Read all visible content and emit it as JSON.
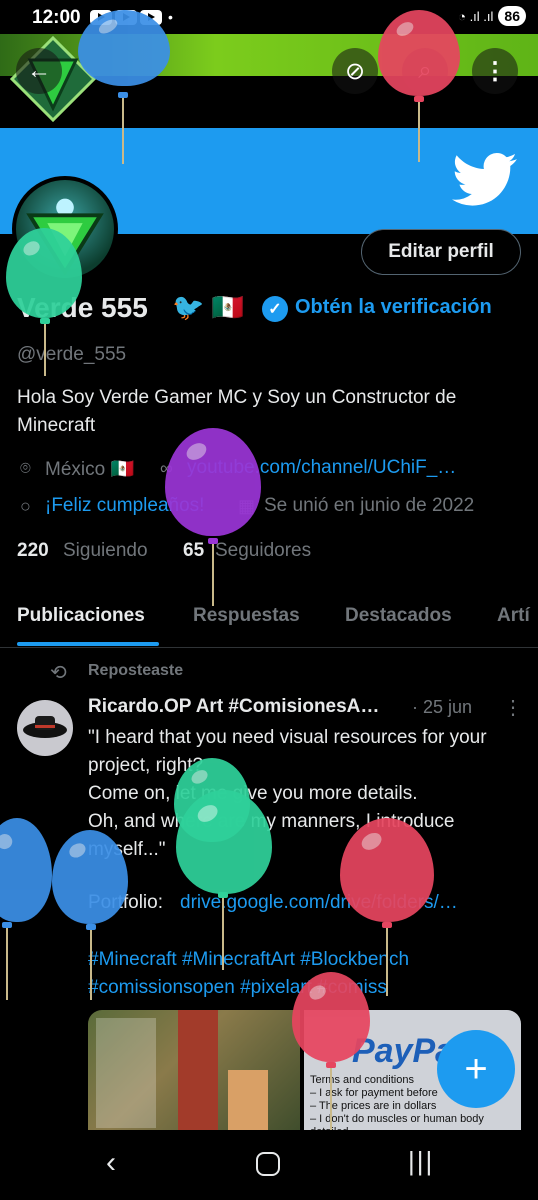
{
  "status_bar": {
    "time": "12:00",
    "dot": "•",
    "battery": "86",
    "signal": "◔ .ıl .ıl"
  },
  "header": {
    "back_icon": "←",
    "no_translate_icon": "⊘",
    "search_icon": "⌕",
    "more_icon": "⋮"
  },
  "profile": {
    "edit_label": "Editar perfil",
    "display_name": "Verde 555",
    "name_emoji": "🐦 🇲🇽",
    "verify_check": "✓",
    "get_verified": "Obtén la verificación",
    "handle": "@verde_555",
    "bio": "Hola Soy Verde Gamer MC y Soy un Constructor de Minecraft",
    "location": "México 🇲🇽",
    "link": "youtube.com/channel/UChiF_…",
    "birthday": "¡Feliz cumpleaños!",
    "joined": "Se unió en junio de 2022",
    "following_count": "220",
    "following_label": "Siguiendo",
    "followers_count": "65",
    "followers_label": "Seguidores"
  },
  "tabs": [
    "Publicaciones",
    "Respuestas",
    "Destacados",
    "Artí"
  ],
  "post": {
    "repost_label": "Reposteaste",
    "author": "Ricardo.OP Art #ComisionesA…",
    "date": "· 25 jun",
    "text": "\"I heard that you need visual resources for your project, right?\nCome on, let me give you more details.\nOh, and where are my manners, I introduce myself...\"",
    "portfolio_label": "Portfolio:",
    "portfolio_link": "drive.google.com/drive/folders/…",
    "hashtags": "#Minecraft #MinecraftArt #Blockbench #comissionsopen #pixelart #comiss",
    "media_right_title": "PayPal",
    "media_right_terms": "Terms and conditions\n– I ask for payment before\n– The prices are in dollars\n– I don't do muscles or human body detailed\n– I don't do explicit gore"
  },
  "compose_icon": "+",
  "nav": {
    "back": "‹",
    "recents": "|||"
  },
  "colors": {
    "accent": "#1d9bf0",
    "background": "#000000",
    "muted": "#71767b"
  }
}
